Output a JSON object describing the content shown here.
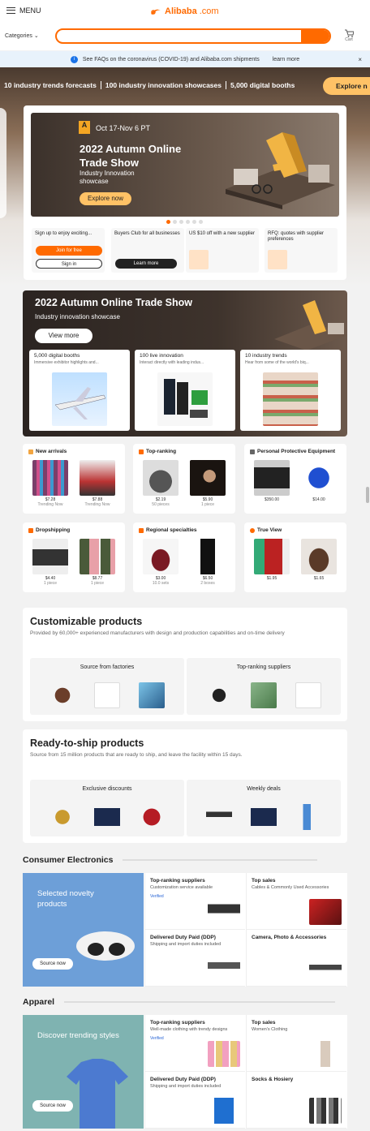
{
  "header": {
    "menu_label": "MENU",
    "logo": "Alibaba",
    "logo_suffix": ".com",
    "categories": "Categories",
    "search_placeholder": "",
    "cart_label": "Cart"
  },
  "notice": {
    "text": "See FAQs on the coronavirus (COVID-19) and Alibaba.com shipments",
    "link": "learn more"
  },
  "strip": {
    "items": [
      "10 industry trends forecasts",
      "100 industry innovation showcases",
      "5,000 digital booths"
    ],
    "button": "Explore n"
  },
  "hero": {
    "date": "Oct 17-Nov 6 PT",
    "title": "2022 Autumn Online Trade Show",
    "subtitle": "Industry Innovation showcase",
    "button": "Explore now",
    "promos": [
      {
        "text": "Sign up to enjoy exciting...",
        "btn1": "Join for free",
        "btn2": "Sign in"
      },
      {
        "text": "Buyers Club for all businesses",
        "btn1": "Learn more"
      },
      {
        "text": "US $10 off with a new supplier"
      },
      {
        "text": "RFQ: quotes with supplier preferences"
      }
    ]
  },
  "trade_show": {
    "title": "2022 Autumn Online Trade Show",
    "subtitle": "Industry innovation showcase",
    "button": "View more",
    "cards": [
      {
        "title": "5,000 digital booths",
        "desc": "Immersive exhibitor highlights and..."
      },
      {
        "title": "100 live innovation",
        "desc": "Interact directly with leading indus..."
      },
      {
        "title": "10 industry trends",
        "desc": "Hear from some of the world's biq..."
      }
    ]
  },
  "tiles": [
    {
      "title": "New arrivals",
      "items": [
        {
          "price": "$7.28",
          "sub": "Trending Now"
        },
        {
          "price": "$7.88",
          "sub": "Trending Now"
        }
      ]
    },
    {
      "title": "Top-ranking",
      "items": [
        {
          "price": "$2.19",
          "sub": "50 pieces"
        },
        {
          "price": "$5.90",
          "sub": "1 piece"
        }
      ]
    },
    {
      "title": "Personal Protective Equipment",
      "items": [
        {
          "price": "$350.00",
          "sub": ""
        },
        {
          "price": "$14.00",
          "sub": ""
        }
      ]
    },
    {
      "title": "Dropshipping",
      "items": [
        {
          "price": "$4.40",
          "sub": "1 piece"
        },
        {
          "price": "$8.77",
          "sub": "1 piece"
        }
      ]
    },
    {
      "title": "Regional specialties",
      "items": [
        {
          "price": "$3.00",
          "sub": "10.0 sets"
        },
        {
          "price": "$6.50",
          "sub": "2 boxes"
        }
      ]
    },
    {
      "title": "True View",
      "items": [
        {
          "price": "$1.95",
          "sub": ""
        },
        {
          "price": "$1.65",
          "sub": ""
        }
      ]
    }
  ],
  "customizable": {
    "title": "Customizable products",
    "desc": "Provided by 60,000+ experienced manufacturers with design and production capabilities and on-time delivery",
    "box1": "Source from factories",
    "box2": "Top-ranking suppliers"
  },
  "ready": {
    "title": "Ready-to-ship products",
    "desc": "Source from 15 million products that are ready to ship, and leave the facility within 15 days.",
    "box1": "Exclusive discounts",
    "box2": "Weekly deals"
  },
  "electronics": {
    "heading": "Consumer Electronics",
    "feature": "Selected novelty products",
    "source": "Source now",
    "cells": [
      {
        "title": "Top-ranking suppliers",
        "desc": "Customization service available"
      },
      {
        "title": "Top sales",
        "desc": "Cables & Commonly Used Accessories"
      },
      {
        "title": "Delivered Duty Paid (DDP)",
        "desc": "Shipping and import duties included"
      },
      {
        "title": "Camera, Photo & Accessories",
        "desc": ""
      }
    ]
  },
  "apparel": {
    "heading": "Apparel",
    "feature": "Discover trending styles",
    "source": "Source now",
    "cells": [
      {
        "title": "Top-ranking suppliers",
        "desc": "Well-made clothing with trendy designs"
      },
      {
        "title": "Top sales",
        "desc": "Women's Clothing"
      },
      {
        "title": "Delivered Duty Paid (DDP)",
        "desc": "Shipping and import duties included"
      },
      {
        "title": "Socks & Hosiery",
        "desc": ""
      }
    ]
  },
  "badges": {
    "verified": "Verified"
  }
}
